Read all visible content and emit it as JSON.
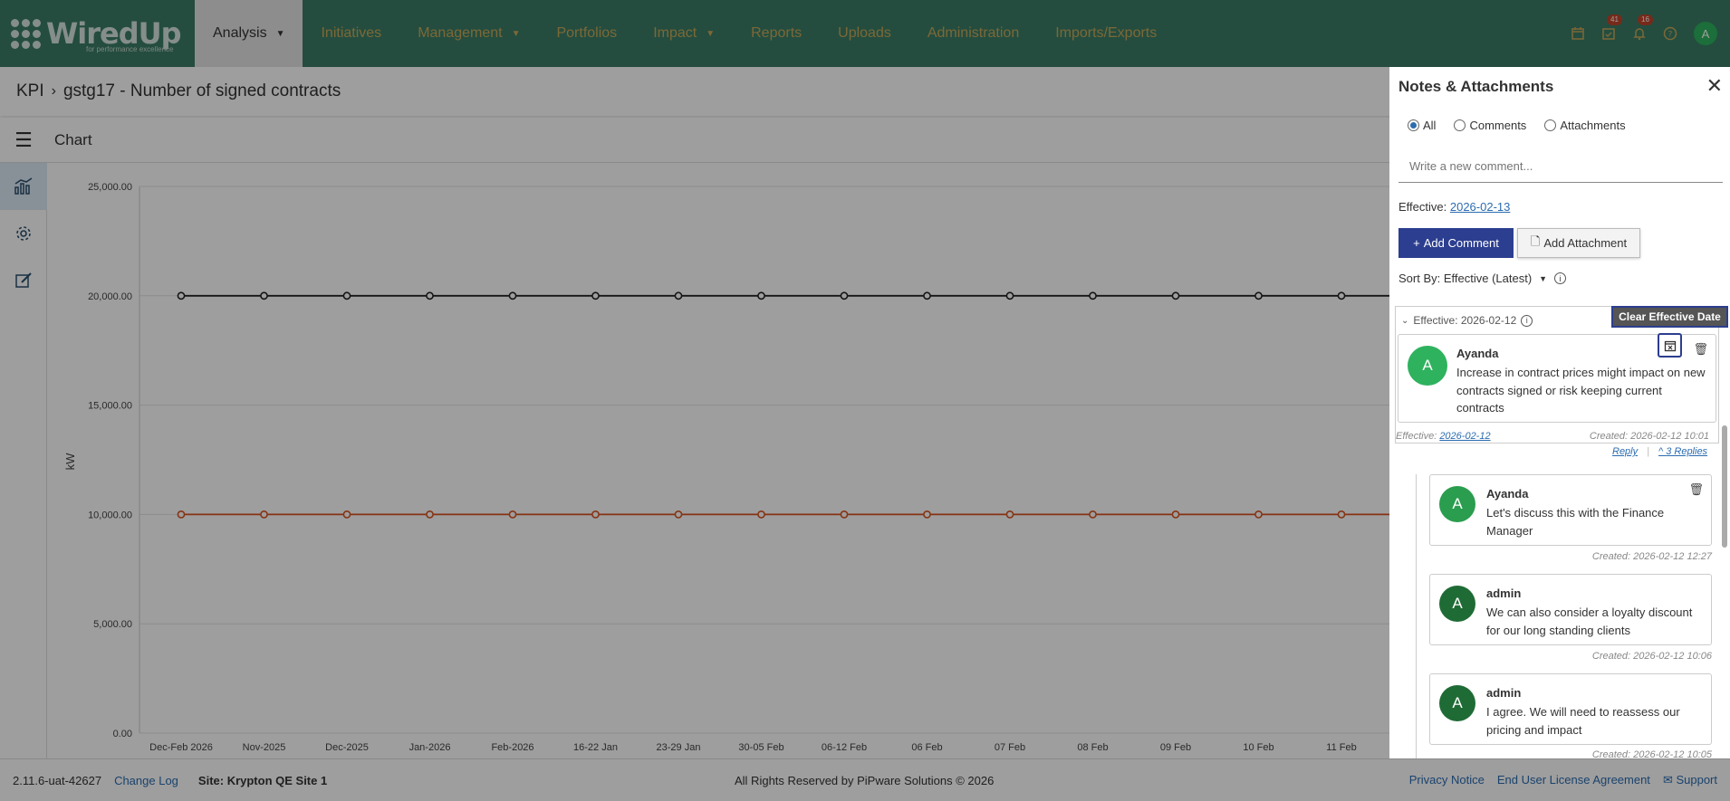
{
  "app": {
    "logo_text": "WiredUp",
    "logo_sub": "for performance excellence"
  },
  "nav": {
    "items": [
      {
        "label": "Analysis",
        "active": true,
        "dropdown": true
      },
      {
        "label": "Initiatives",
        "active": false,
        "dropdown": false
      },
      {
        "label": "Management",
        "active": false,
        "dropdown": true
      },
      {
        "label": "Portfolios",
        "active": false,
        "dropdown": false
      },
      {
        "label": "Impact",
        "active": false,
        "dropdown": true
      },
      {
        "label": "Reports",
        "active": false,
        "dropdown": false
      },
      {
        "label": "Uploads",
        "active": false,
        "dropdown": false
      },
      {
        "label": "Administration",
        "active": false,
        "dropdown": false
      },
      {
        "label": "Imports/Exports",
        "active": false,
        "dropdown": false
      }
    ],
    "tasks_badge": "41",
    "notifications_badge": "16",
    "user_initial": "A",
    "accent": "#3a7d66",
    "link_color": "#c9a95a"
  },
  "breadcrumb": {
    "root": "KPI",
    "current": "gstg17 - Number of signed contracts"
  },
  "chart_header": {
    "title": "Chart"
  },
  "chart_data": {
    "type": "line",
    "ylabel": "kW",
    "ylim": [
      0,
      25000
    ],
    "yticks": [
      "25,000.00",
      "20,000.00",
      "15,000.00",
      "10,000.00",
      "5,000.00",
      "0.00"
    ],
    "categories": [
      "Dec-Feb 2026",
      "Nov-2025",
      "Dec-2025",
      "Jan-2026",
      "Feb-2026",
      "16-22 Jan",
      "23-29 Jan",
      "30-05 Feb",
      "06-12 Feb",
      "06 Feb",
      "07 Feb",
      "08 Feb",
      "09 Feb",
      "10 Feb",
      "11 Feb"
    ],
    "series": [
      {
        "color": "#222222",
        "values": [
          20000,
          20000,
          20000,
          20000,
          20000,
          20000,
          20000,
          20000,
          20000,
          20000,
          20000,
          20000,
          20000,
          20000,
          20000
        ]
      },
      {
        "color": "#d9531e",
        "values": [
          10000,
          10000,
          10000,
          10000,
          10000,
          10000,
          10000,
          10000,
          10000,
          10000,
          10000,
          10000,
          10000,
          10000,
          10000
        ]
      }
    ],
    "grid": true
  },
  "footer": {
    "version": "2.11.6-uat-42627",
    "change_log": "Change Log",
    "site": "Site: Krypton QE Site 1",
    "copyright": "All Rights Reserved by PiPware Solutions © 2026",
    "privacy": "Privacy Notice",
    "eula": "End User License Agreement",
    "support": "Support"
  },
  "panel": {
    "title": "Notes & Attachments",
    "filters": [
      "All",
      "Comments",
      "Attachments"
    ],
    "selected_filter": "All",
    "comment_placeholder": "Write a new comment...",
    "effective_label": "Effective:",
    "effective_date": "2026-02-13",
    "add_comment": "Add Comment",
    "add_attachment": "Add Attachment",
    "sort_by": "Sort By: Effective (Latest)",
    "group": {
      "header": "Effective: 2026-02-12",
      "tooltip": "Clear Effective Date",
      "comment": {
        "initial": "A",
        "author": "Ayanda",
        "text": "Increase in contract prices might impact on new contracts signed or risk keeping current contracts",
        "effective_label": "Effective:",
        "effective_date": "2026-02-12",
        "created": "Created: 2026-02-12 10:01"
      }
    },
    "reply": "Reply",
    "replies_toggle": "3 Replies",
    "replies": [
      {
        "initial": "A",
        "author": "Ayanda",
        "text": "Let's discuss this with the Finance Manager",
        "created": "Created: 2026-02-12 12:27",
        "color": "#2a9d4f"
      },
      {
        "initial": "A",
        "author": "admin",
        "text": "We can also consider a loyalty discount for our long standing clients",
        "created": "Created: 2026-02-12 10:06",
        "color": "#1f6b35"
      },
      {
        "initial": "A",
        "author": "admin",
        "text": "I agree. We will need to reassess our pricing and impact",
        "created": "Created: 2026-02-12 10:05",
        "color": "#1f6b35"
      }
    ]
  }
}
